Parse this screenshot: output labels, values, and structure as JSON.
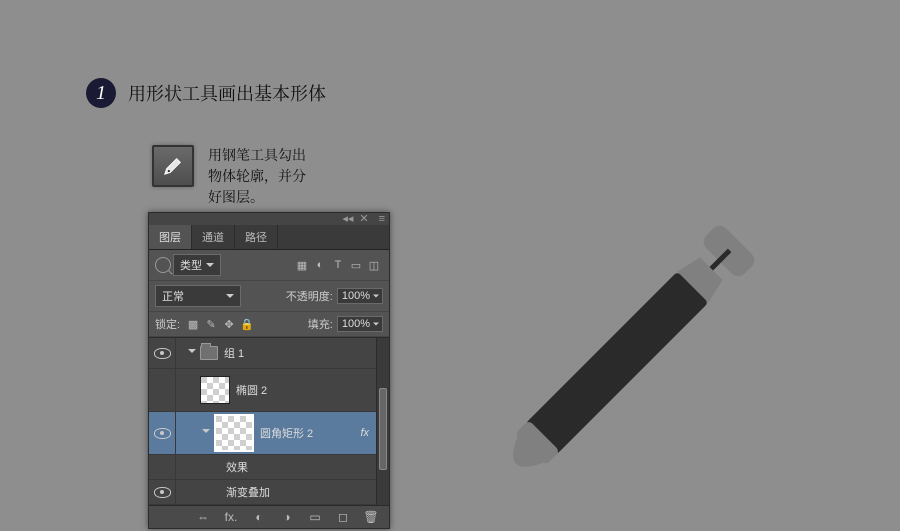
{
  "step": {
    "num": "1",
    "title": "用形状工具画出基本形体"
  },
  "pen": {
    "line1": "用钢笔工具勾出",
    "line2": "物体轮廓，并分",
    "line3": "好图层。"
  },
  "panel": {
    "tabs": {
      "layers": "图层",
      "channels": "通道",
      "paths": "路径"
    },
    "filter_label": "类型",
    "blend_mode": "正常",
    "opacity_label": "不透明度:",
    "opacity_value": "100%",
    "lock_label": "锁定:",
    "fill_label": "填充:",
    "fill_value": "100%",
    "layers": {
      "group": "组 1",
      "ellipse": "椭圆 2",
      "roundrect": "圆角矩形 2",
      "fx_label": "fx",
      "effects": "效果",
      "gradient": "渐变叠加"
    },
    "footer_icons": {
      "link": "⇔",
      "fx": "fx.",
      "mask": "◐",
      "adjust": "◑",
      "folder": "▭",
      "new": "◻",
      "trash": "🗑"
    }
  }
}
